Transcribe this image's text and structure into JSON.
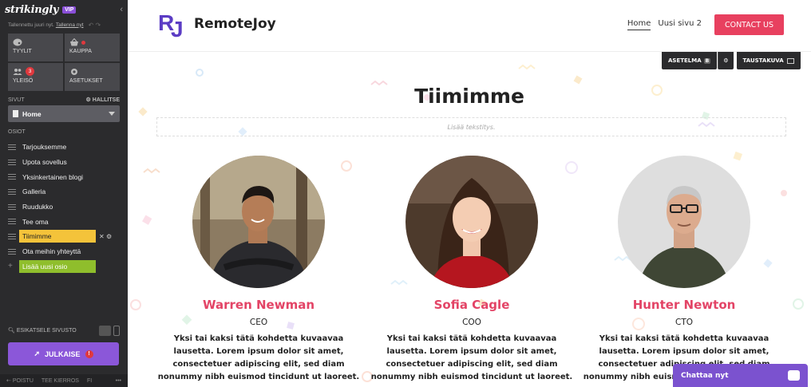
{
  "sidebar": {
    "logo": "strikingly",
    "vip_badge": "VIP",
    "saved_status": "Tallennettu juuri nyt.",
    "save_link": "Tallenna nyt",
    "tiles": [
      {
        "label": "TYYLIT",
        "icon": "palette-icon"
      },
      {
        "label": "KAUPPA",
        "icon": "shopping-basket-icon"
      },
      {
        "label": "YLEISÖ",
        "icon": "people-icon",
        "badge": "3"
      },
      {
        "label": "ASETUKSET",
        "icon": "gear-icon"
      }
    ],
    "pages_label": "SIVUT",
    "manage_label": "HALLITSE",
    "current_page": "Home",
    "sections_label": "OSIOT",
    "sections": [
      "Tarjouksemme",
      "Upota sovellus",
      "Yksinkertainen blogi",
      "Galleria",
      "Ruudukko",
      "Tee oma",
      "Tiimimme",
      "Ota meihin yhteyttä"
    ],
    "active_section": "Tiimimme",
    "add_section": "Lisää uusi osio",
    "preview_label": "ESIKATSELE SIVUSTO",
    "publish_label": "JULKAISE",
    "footer": [
      "POISTU",
      "TEE KIERROS",
      "FI",
      "•••"
    ]
  },
  "header": {
    "brand_initials": "RJ",
    "brand_name": "RemoteJoy",
    "nav": [
      "Home",
      "Uusi sivu 2"
    ],
    "cta": "CONTACT US"
  },
  "editor_buttons": {
    "settings": "ASETELMA",
    "settings_badge": "B",
    "background": "TAUSTAKUVA"
  },
  "section": {
    "title": "Tiimimme",
    "subtitle_placeholder": "Lisää tekstitys."
  },
  "members": [
    {
      "name": "Warren Newman",
      "role": "CEO",
      "bio": "Yksi tai kaksi tätä kohdetta kuvaavaa lausetta. Lorem ipsum dolor sit amet, consectetuer adipiscing elit, sed diam nonummy nibh euismod tincidunt ut laoreet."
    },
    {
      "name": "Sofia Cagle",
      "role": "COO",
      "bio": "Yksi tai kaksi tätä kohdetta kuvaavaa lausetta. Lorem ipsum dolor sit amet, consectetuer adipiscing elit, sed diam nonummy nibh euismod tincidunt ut laoreet."
    },
    {
      "name": "Hunter Newton",
      "role": "CTO",
      "bio": "Yksi tai kaksi tätä kohdetta kuvaavaa lausetta. Lorem ipsum dolor sit amet, consectetuer adipiscing elit, sed diam nonummy nibh euismod tincidunt ut laoreet."
    }
  ],
  "chat": {
    "label": "Chattaa nyt"
  },
  "colors": {
    "accent_pink": "#e34466",
    "cta": "#e8405f",
    "publish": "#8b57d9",
    "active_section": "#f4c33a",
    "add_section": "#8fbe2c",
    "brand": "#5b3cc4"
  }
}
